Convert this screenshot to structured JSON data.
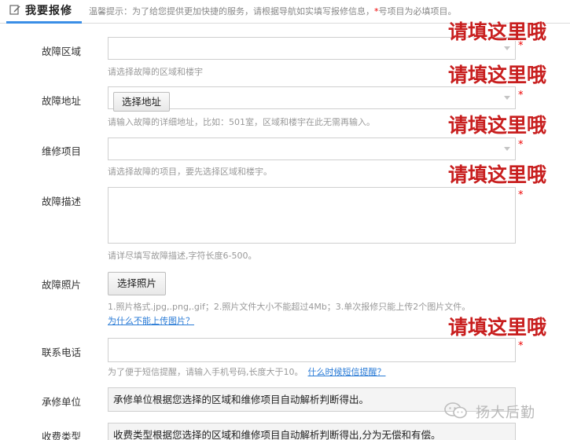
{
  "header": {
    "tab_label": "我要报修",
    "tip_prefix": "温馨提示：为了给您提供更加快捷的服务，请根据导航如实填写报修信息，",
    "tip_star": "*",
    "tip_suffix": "号项目为必填项目。"
  },
  "form": {
    "area": {
      "label": "故障区域",
      "value": "",
      "hint": "请选择故障的区域和楼宇"
    },
    "address": {
      "label": "故障地址",
      "button": "选择地址",
      "value": "",
      "hint": "请输入故障的详细地址，比如：501室，区域和楼宇在此无需再输入。"
    },
    "item": {
      "label": "维修项目",
      "value": "",
      "hint": "请选择故障的项目，要先选择区域和楼宇。"
    },
    "description": {
      "label": "故障描述",
      "value": "",
      "hint": "请详尽填写故障描述,字符长度6-500。"
    },
    "photo": {
      "label": "故障照片",
      "button": "选择照片",
      "hint": "1.照片格式.jpg,.png,.gif；2.照片文件大小不能超过4Mb；3.单次报修只能上传2个图片文件。",
      "link": "为什么不能上传图片？"
    },
    "phone": {
      "label": "联系电话",
      "value": "",
      "hint": "为了便于短信提醒，请输入手机号码,长度大于10。",
      "link": "什么时候短信提醒？"
    },
    "unit": {
      "label": "承修单位",
      "value": "承修单位根据您选择的区域和维修项目自动解析判断得出。"
    },
    "fee_type": {
      "label": "收费类型",
      "value": "收费类型根据您选择的区域和维修项目自动解析判断得出,分为无偿和有偿。"
    },
    "required_mark": "*"
  },
  "overlay_text": "请填这里哦",
  "watermark": {
    "text": "扬大后勤"
  },
  "colors": {
    "accent": "#3a8ee6",
    "required": "#e00000",
    "overlay": "#c81e1e",
    "link": "#2a7bd6"
  },
  "icons": {
    "tab": "edit-icon",
    "select": "chevron-down-icon",
    "watermark": "wechat-icon"
  }
}
